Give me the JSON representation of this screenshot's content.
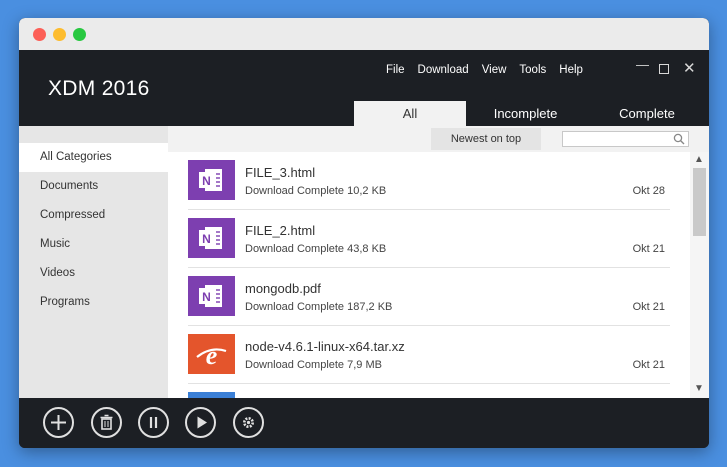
{
  "app": {
    "title": "XDM 2016"
  },
  "menu": {
    "items": [
      "File",
      "Download",
      "View",
      "Tools",
      "Help"
    ]
  },
  "window_controls": {
    "minimize": "—",
    "close": "✕"
  },
  "tabs": [
    {
      "label": "All",
      "active": true
    },
    {
      "label": "Incomplete",
      "active": false
    },
    {
      "label": "Complete",
      "active": false
    }
  ],
  "sidebar": {
    "items": [
      "All Categories",
      "Documents",
      "Compressed",
      "Music",
      "Videos",
      "Programs"
    ],
    "selected": "All Categories"
  },
  "toolbar": {
    "sort_label": "Newest on top",
    "search_placeholder": ""
  },
  "downloads": [
    {
      "name": "FILE_3.html",
      "status": "Download Complete 10,2 KB",
      "date": "Okt 28",
      "icon": "onenote-icon"
    },
    {
      "name": "FILE_2.html",
      "status": "Download Complete 43,8 KB",
      "date": "Okt 21",
      "icon": "onenote-icon"
    },
    {
      "name": "mongodb.pdf",
      "status": "Download Complete 187,2 KB",
      "date": "Okt 21",
      "icon": "onenote-icon"
    },
    {
      "name": "node-v4.6.1-linux-x64.tar.xz",
      "status": "Download Complete 7,9 MB",
      "date": "Okt 21",
      "icon": "archive-icon"
    }
  ],
  "bottom_actions": [
    "add-icon",
    "delete-icon",
    "pause-icon",
    "resume-icon",
    "settings-icon"
  ],
  "colors": {
    "dark_bg": "#1c1f24",
    "onenote_purple": "#7d3fb0",
    "archive_orange": "#e4552c",
    "background_blue": "#4a8fe0"
  }
}
